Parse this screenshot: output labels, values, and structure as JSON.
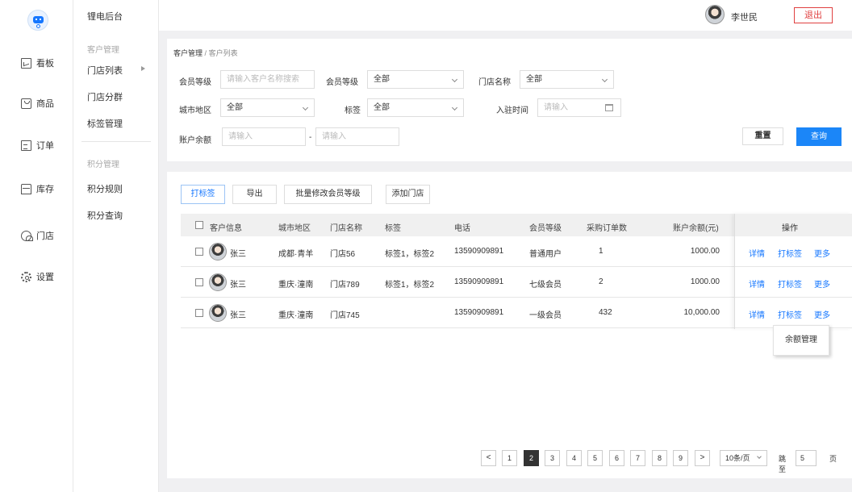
{
  "app": {
    "brand": "锂电后台"
  },
  "nav": [
    {
      "label": "看板",
      "icon": "chart-board-icon"
    },
    {
      "label": "商品",
      "icon": "goods-box-icon"
    },
    {
      "label": "订单",
      "icon": "order-doc-icon"
    },
    {
      "label": "库存",
      "icon": "inventory-store-icon"
    },
    {
      "label": "门店",
      "icon": "store-user-icon"
    },
    {
      "label": "设置",
      "icon": "gear-icon"
    }
  ],
  "submenu": {
    "group1": "客户管理",
    "items1": [
      "门店列表",
      "门店分群",
      "标签管理"
    ],
    "group2": "积分管理",
    "items2": [
      "积分规则",
      "积分查询"
    ]
  },
  "header": {
    "username": "李世民",
    "logout": "退出"
  },
  "breadcrumb": {
    "parent": "客户管理",
    "sep": "/",
    "current": "客户列表"
  },
  "filters": {
    "member_level_search": {
      "label": "会员等级",
      "placeholder": "请输入客户名称搜索"
    },
    "member_level": {
      "label": "会员等级",
      "value": "全部"
    },
    "store_name": {
      "label": "门店名称",
      "value": "全部"
    },
    "city": {
      "label": "城市地区",
      "value": "全部"
    },
    "tag": {
      "label": "标签",
      "value": "全部"
    },
    "join_time": {
      "label": "入驻时间",
      "placeholder": "请输入"
    },
    "balance": {
      "label": "账户余额",
      "min_placeholder": "请输入",
      "dash": "-",
      "max_placeholder": "请输入"
    },
    "reset": "重置",
    "query": "查询"
  },
  "toolbar": {
    "tag": "打标签",
    "export": "导出",
    "batch_level": "批量修改会员等级",
    "add_store": "添加门店"
  },
  "table": {
    "headers": [
      "客户信息",
      "城市地区",
      "门店名称",
      "标签",
      "电话",
      "会员等级",
      "采购订单数",
      "账户余额(元)",
      "操作"
    ],
    "rows": [
      {
        "name": "张三",
        "city": "成都·青羊",
        "store": "门店56",
        "tags": "标签1，标签2",
        "phone": "13590909891",
        "level": "普通用户",
        "orders": "1",
        "balance": "1000.00"
      },
      {
        "name": "张三",
        "city": "重庆·潼南",
        "store": "门店789",
        "tags": "标签1，标签2",
        "phone": "13590909891",
        "level": "七级会员",
        "orders": "2",
        "balance": "1000.00"
      },
      {
        "name": "张三",
        "city": "重庆·潼南",
        "store": "门店745",
        "tags": "",
        "phone": "13590909891",
        "level": "一级会员",
        "orders": "432",
        "balance": "10,000.00"
      }
    ],
    "ops": {
      "detail": "详情",
      "tag": "打标签",
      "more": "更多"
    },
    "popover": "余额管理"
  },
  "pagination": {
    "prev": "<",
    "next": ">",
    "pages": [
      "1",
      "2",
      "3",
      "4",
      "5",
      "6",
      "7",
      "8",
      "9"
    ],
    "current": "2",
    "page_size": "10条/页",
    "jump_label": "跳至",
    "jump_value": "5",
    "unit": "页"
  }
}
